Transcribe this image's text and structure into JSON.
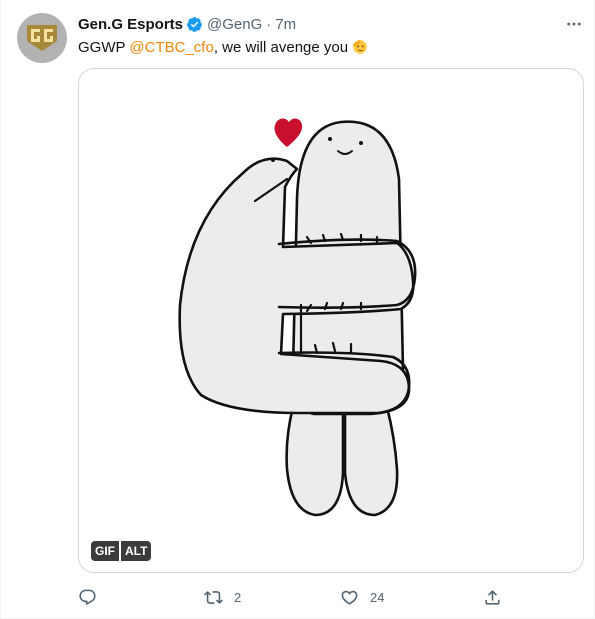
{
  "author": {
    "display_name": "Gen.G Esports",
    "handle": "@GenG",
    "separator": "·",
    "time": "7m"
  },
  "tweet": {
    "text_before": "GGWP ",
    "mention": "@CTBC_cfo",
    "text_after": ", we will avenge you",
    "emoji": "saluting-face"
  },
  "media": {
    "gif_label": "GIF",
    "alt_label": "ALT"
  },
  "actions": {
    "reply_count": "",
    "retweet_count": "2",
    "like_count": "24"
  },
  "colors": {
    "mention": "#f2870a",
    "verified": "#1d9bf0",
    "muted": "#536471",
    "heart": "#c8102e"
  },
  "icons": [
    "gen-g-logo-icon",
    "verified-badge-icon",
    "more-options-icon",
    "reply-icon",
    "retweet-icon",
    "like-icon",
    "share-icon"
  ]
}
